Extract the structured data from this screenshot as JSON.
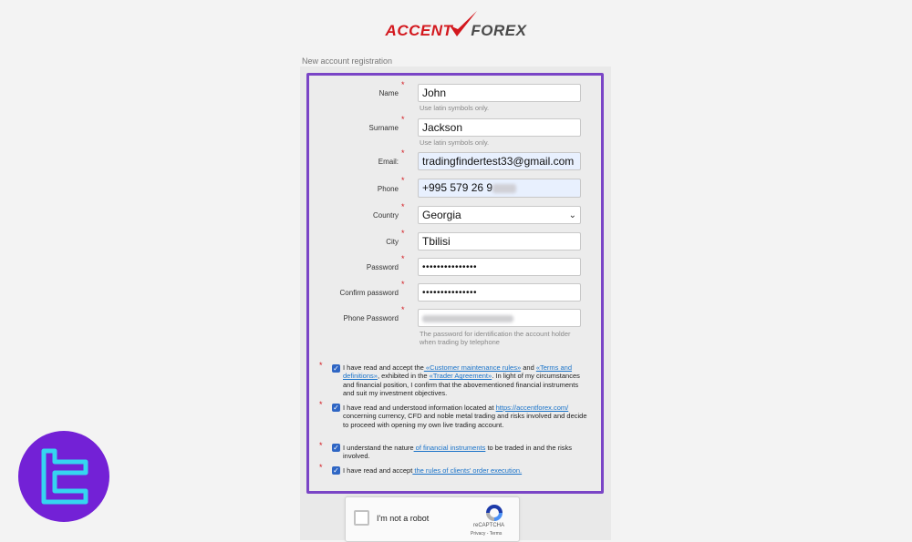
{
  "brand": {
    "accent": "ACCENT",
    "forex": "FOREX",
    "accent_color": "#d3181e",
    "frame_color": "#7a45c6"
  },
  "section_label": "New account registration",
  "form": {
    "name": {
      "label": "Name",
      "value": "John",
      "hint": "Use latin symbols only."
    },
    "surname": {
      "label": "Surname",
      "value": "Jackson",
      "hint": "Use latin symbols only."
    },
    "email": {
      "label": "Email:",
      "value": "tradingfindertest33@gmail.com"
    },
    "phone": {
      "label": "Phone",
      "value": "+995 579 26 9"
    },
    "country": {
      "label": "Country",
      "value": "Georgia"
    },
    "city": {
      "label": "City",
      "value": "Tbilisi"
    },
    "password": {
      "label": "Password",
      "value": "•••••••••••••••"
    },
    "confirm_password": {
      "label": "Confirm password",
      "value": "•••••••••••••••"
    },
    "phone_password": {
      "label": "Phone Password",
      "hint": "The password for identification the account holder when trading by telephone"
    }
  },
  "agreements": [
    {
      "pre": "I have read and accept the",
      "link1": " «Customer maintenance rules»",
      "mid1": " and ",
      "link2": "«Terms and definitions»",
      "mid2": ", exhibited in the ",
      "link3": "«Trader Agreement»",
      "post": ". In light of my circumstances and financial position, I confirm that the abovementioned financial instruments and suit my investment objectives."
    },
    {
      "pre": " I have read and understood information located at ",
      "link1": "https://accentforex.com/",
      "post": " concerning currency, CFD and noble metal trading and risks involved and decide to proceed with opening my own live trading account."
    },
    {
      "pre": " I understand the nature",
      "link1": " of financial instruments",
      "post": " to be traded in and the risks involved."
    },
    {
      "pre": " I have read and accept",
      "link1": " the rules of clients' order execution."
    }
  ],
  "captcha": {
    "label": "I'm not a robot",
    "brand": "reCAPTCHA",
    "terms": "Privacy - Terms"
  },
  "icons": {
    "checkmark": "checkmark-icon",
    "chevron": "chevron-down-icon",
    "badge": "tradingfinder-logo-icon"
  }
}
